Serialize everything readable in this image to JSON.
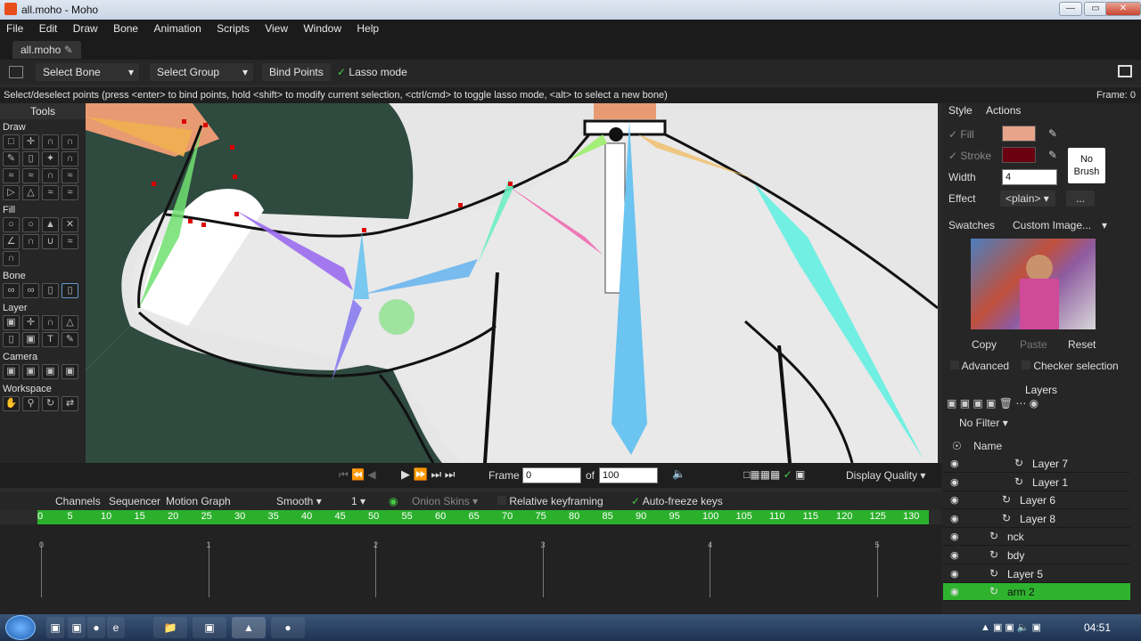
{
  "window": {
    "title": "all.moho - Moho"
  },
  "menu": [
    "File",
    "Edit",
    "Draw",
    "Bone",
    "Animation",
    "Scripts",
    "View",
    "Window",
    "Help"
  ],
  "doc_tab": "all.moho",
  "tool_options": {
    "select_bone": "Select Bone",
    "select_group": "Select Group",
    "bind_points": "Bind Points",
    "lasso_mode": "Lasso mode"
  },
  "status": {
    "message": "Select/deselect points (press <enter> to bind points, hold <shift> to modify current selection, <ctrl/cmd> to toggle lasso mode, <alt> to select a new bone)",
    "frame": "Frame: 0"
  },
  "tools": {
    "header": "Tools",
    "sections": [
      "Draw",
      "Fill",
      "Bone",
      "Layer",
      "Camera",
      "Workspace"
    ]
  },
  "style_panel": {
    "tabs": [
      "Style",
      "Actions"
    ],
    "fill_label": "Fill",
    "stroke_label": "Stroke",
    "no_brush": "No Brush",
    "width_label": "Width",
    "width_value": "4",
    "effect_label": "Effect",
    "effect_value": "<plain>",
    "effect_more": "...",
    "swatches_label": "Swatches",
    "swatches_value": "Custom Image...",
    "copy": "Copy",
    "paste": "Paste",
    "reset": "Reset",
    "advanced": "Advanced",
    "checker_selection": "Checker selection",
    "fill_color": "#e8a48a",
    "stroke_color": "#6b0010"
  },
  "layers": {
    "header": "Layers",
    "filter": "No Filter",
    "name_col": "Name",
    "items": [
      {
        "name": "Layer 7",
        "active": false
      },
      {
        "name": "Layer 1",
        "active": false
      },
      {
        "name": "Layer 6",
        "active": false
      },
      {
        "name": "Layer 8",
        "active": false
      },
      {
        "name": "nck",
        "active": false
      },
      {
        "name": "bdy",
        "active": false
      },
      {
        "name": "Layer 5",
        "active": false
      },
      {
        "name": "arm 2",
        "active": true
      }
    ]
  },
  "timeline": {
    "frame_label": "Frame",
    "frame_value": "0",
    "of_label": "of",
    "total": "100",
    "display_quality": "Display Quality",
    "tabs": [
      "Channels",
      "Sequencer",
      "Motion Graph"
    ],
    "interp": "Smooth",
    "interp_value": "1",
    "onion_skins": "Onion Skins",
    "relative_keyframing": "Relative keyframing",
    "auto_freeze": "Auto-freeze keys",
    "ruler": [
      "0",
      "5",
      "10",
      "15",
      "20",
      "25",
      "30",
      "35",
      "40",
      "45",
      "50",
      "55",
      "60",
      "65",
      "70",
      "75",
      "80",
      "85",
      "90",
      "95",
      "100",
      "105",
      "110",
      "115",
      "120",
      "125",
      "130"
    ],
    "track_marks": [
      "0",
      "1",
      "2",
      "3",
      "4",
      "5"
    ]
  },
  "taskbar": {
    "clock": "04:51"
  }
}
